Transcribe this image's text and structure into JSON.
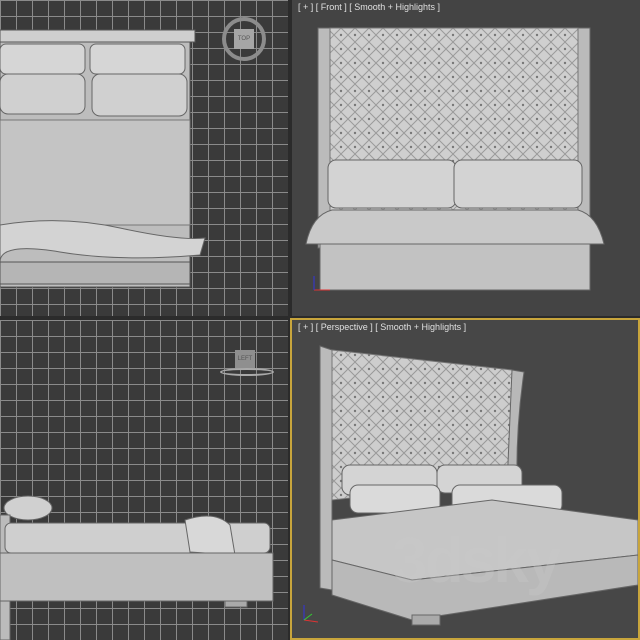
{
  "viewports": {
    "top": {
      "name": "Top",
      "cube_label": "TOP"
    },
    "front": {
      "label": "[ + ] [ Front ] [ Smooth + Highlights ]"
    },
    "left": {
      "name": "Left",
      "cube_label": "LEFT"
    },
    "perspective": {
      "label": "[ + ] [ Perspective ] [ Smooth + Highlights ]",
      "active": true
    }
  },
  "watermark": "3dsky",
  "colors": {
    "active_border": "#c8a53c",
    "viewport_bg": "#3f3f3f",
    "grid_line": "#8a8a8a"
  }
}
